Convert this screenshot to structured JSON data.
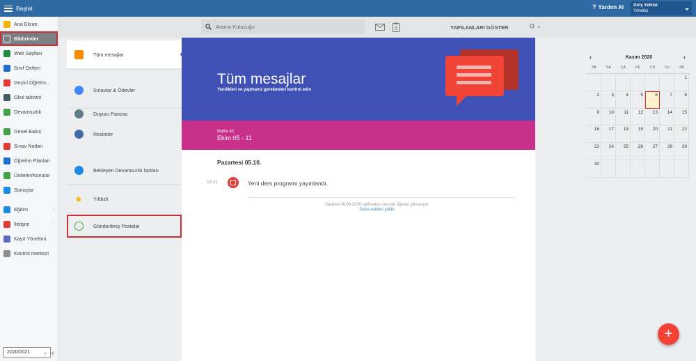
{
  "topbar": {
    "start_label": "Başlat",
    "help_label": "Yardım Al",
    "role_title": "Giriş Yetkisi:",
    "role_value": "Yönetici"
  },
  "sidebar": {
    "items": [
      {
        "label": "Ana Ekran",
        "icon": "star-icon",
        "color": "#f5b400"
      },
      {
        "label": "Bildirimler",
        "icon": "envelope-icon",
        "color": "#ffffff",
        "active": true
      },
      {
        "label": "Web Sayfası",
        "icon": "home-icon",
        "color": "#1e8e3e"
      },
      {
        "label": "Sınıf Defteri",
        "icon": "notebook-icon",
        "color": "#1e6ed2"
      },
      {
        "label": "Geçici Öğretm...",
        "icon": "teacher-icon",
        "color": "#e53935"
      },
      {
        "label": "Okul takvimi",
        "icon": "calendar-icon",
        "color": "#455a64"
      },
      {
        "label": "Devamsızlık",
        "icon": "person-icon",
        "color": "#43a047"
      },
      {
        "label": "Genel Bakış",
        "icon": "check-circle-icon",
        "color": "#43a047"
      },
      {
        "label": "Sınav Notları",
        "icon": "exam-icon",
        "color": "#e53935"
      },
      {
        "label": "Öğretim Planları",
        "icon": "laptop-icon",
        "color": "#1e6ed2"
      },
      {
        "label": "Üniteler/Konular",
        "icon": "shield-icon",
        "color": "#43a047"
      },
      {
        "label": "Sonuçlar",
        "icon": "bar-chart-icon",
        "color": "#1e88e5"
      },
      {
        "label": "Eğitim",
        "icon": "education-icon",
        "color": "#1e88e5",
        "chevron": true
      },
      {
        "label": "İletişim",
        "icon": "chat-icon",
        "color": "#e53935",
        "chevron": true
      },
      {
        "label": "Kayıt Yönetimi",
        "icon": "pencil-icon",
        "color": "#5c6bc0"
      },
      {
        "label": "Kontrol merkezi",
        "icon": "gear-icon",
        "color": "#8d8d8d"
      }
    ],
    "year": "2020/2021"
  },
  "search": {
    "placeholder": "Arama Kutucuğu",
    "show_done": "YAPILANLARI GÖSTER"
  },
  "categories": [
    {
      "label": "Tüm mesajlar",
      "icon": "envelope-icon",
      "color": "#fb8c00"
    },
    {
      "label": "Sınavlar & Ödevler",
      "icon": "google-icon",
      "color": "#4285f4"
    },
    {
      "label": "Duyuru Panosu",
      "icon": "phone-icon",
      "color": "#607d8b"
    },
    {
      "label": "Resimler",
      "icon": "image-icon",
      "color": "#3f6aa5"
    },
    {
      "label": "Bekleyen Devamsızlık Notları",
      "icon": "clipboard-icon",
      "color": "#1e88e5"
    },
    {
      "label": "Yıldızlı",
      "icon": "star-icon",
      "color": "#f5b400"
    },
    {
      "label": "Gönderilmiş Postalar",
      "icon": "sent-icon",
      "color": "#43a047"
    }
  ],
  "hero": {
    "title": "Tüm mesajlar",
    "subtitle": "Yenilikleri ve yapmanız gerekenleri kontrol edin"
  },
  "week": {
    "label": "Hafta 41",
    "range": "Ekim 05 - 11"
  },
  "messages": {
    "day": "Pazartesi 05.10.",
    "time": "15:21",
    "text": "Yeni ders programı yayınlandı.",
    "note": "Sadece 06.09.2020 tarihinden sonraki öğeleri gösteriyor",
    "load_more": "Daha eskileri yükle"
  },
  "calendar": {
    "month": "Kasım 2020",
    "prev": "‹",
    "next": "›",
    "weekdays": [
      "PA",
      "SA",
      "ÇA",
      "PE",
      "CU",
      "CU",
      "PA"
    ],
    "cells": [
      "",
      "",
      "",
      "",
      "",
      "",
      "1",
      "2",
      "3",
      "4",
      "5",
      "6",
      "7",
      "8",
      "9",
      "10",
      "11",
      "12",
      "13",
      "14",
      "15",
      "16",
      "17",
      "18",
      "19",
      "20",
      "21",
      "22",
      "23",
      "24",
      "25",
      "26",
      "27",
      "28",
      "29",
      "30",
      "",
      "",
      "",
      "",
      "",
      ""
    ],
    "today": "6"
  },
  "fab": "+"
}
